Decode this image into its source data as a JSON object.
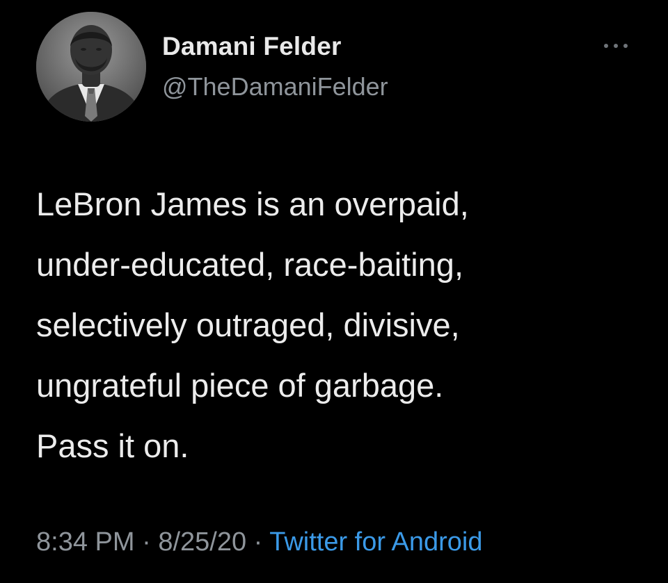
{
  "tweet": {
    "author": {
      "name": "Damani Felder",
      "handle": "@TheDamaniFelder",
      "avatar_icon": "profile-photo"
    },
    "more_icon": "ellipsis-icon",
    "text": "LeBron James is an overpaid,\nunder-educated, race-baiting,\nselectively outraged, divisive,\nungrateful piece of garbage.\nPass it on.",
    "time": "8:34 PM",
    "separator": " · ",
    "date": "8/25/20",
    "source": "Twitter for Android"
  },
  "colors": {
    "background": "#000000",
    "name": "#e9e9e9",
    "secondary": "#8f959b",
    "link": "#3b9ae8"
  }
}
